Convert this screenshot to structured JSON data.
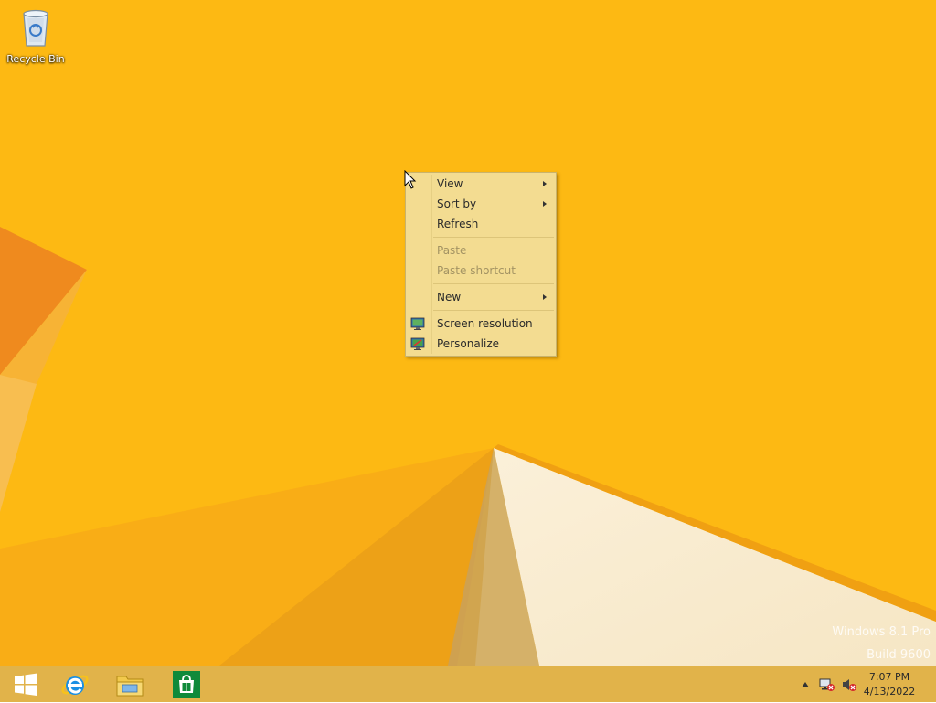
{
  "desktop": {
    "background_color": "#fdb913",
    "icons": [
      {
        "label": "Recycle Bin",
        "icon": "recycle-bin-icon"
      }
    ],
    "watermark": {
      "line1": "Windows 8.1 Pro",
      "line2": "Build 9600"
    }
  },
  "context_menu": {
    "items": [
      {
        "label": "View",
        "submenu": true,
        "enabled": true
      },
      {
        "label": "Sort by",
        "submenu": true,
        "enabled": true
      },
      {
        "label": "Refresh",
        "submenu": false,
        "enabled": true
      },
      {
        "label": "Paste",
        "submenu": false,
        "enabled": false
      },
      {
        "label": "Paste shortcut",
        "submenu": false,
        "enabled": false
      },
      {
        "label": "New",
        "submenu": true,
        "enabled": true
      },
      {
        "label": "Screen resolution",
        "submenu": false,
        "enabled": true,
        "icon": "screen-resolution-icon"
      },
      {
        "label": "Personalize",
        "submenu": false,
        "enabled": true,
        "icon": "personalize-icon"
      }
    ]
  },
  "taskbar": {
    "buttons": [
      {
        "name": "start",
        "icon": "windows-logo-icon"
      },
      {
        "name": "internet-explorer",
        "icon": "internet-explorer-icon"
      },
      {
        "name": "file-explorer",
        "icon": "file-explorer-icon"
      },
      {
        "name": "store",
        "icon": "store-icon"
      }
    ],
    "tray": {
      "icons": [
        "show-hidden-icons-icon",
        "network-icon",
        "volume-muted-icon"
      ],
      "time": "7:07 PM",
      "date": "4/13/2022"
    }
  }
}
